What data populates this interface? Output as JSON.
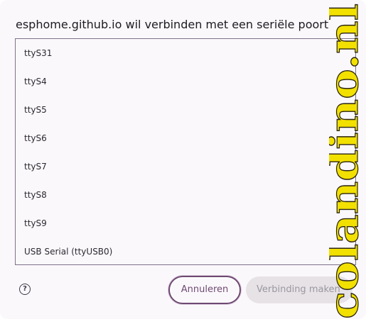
{
  "dialog": {
    "title": "esphome.github.io wil verbinden met een seriële poort"
  },
  "ports": [
    {
      "label": "ttyS31"
    },
    {
      "label": "ttyS4"
    },
    {
      "label": "ttyS5"
    },
    {
      "label": "ttyS6"
    },
    {
      "label": "ttyS7"
    },
    {
      "label": "ttyS8"
    },
    {
      "label": "ttyS9"
    },
    {
      "label": "USB Serial (ttyUSB0)"
    }
  ],
  "footer": {
    "help_icon": "question-circle-icon",
    "help_glyph": "?",
    "cancel_label": "Annuleren",
    "connect_label": "Verbinding maken"
  },
  "watermark": {
    "text": "colandino.nl",
    "color": "#f2e000"
  },
  "colors": {
    "accent": "#6f4a72",
    "disabled_button": "#e6e2e6",
    "border": "#7d7286"
  }
}
